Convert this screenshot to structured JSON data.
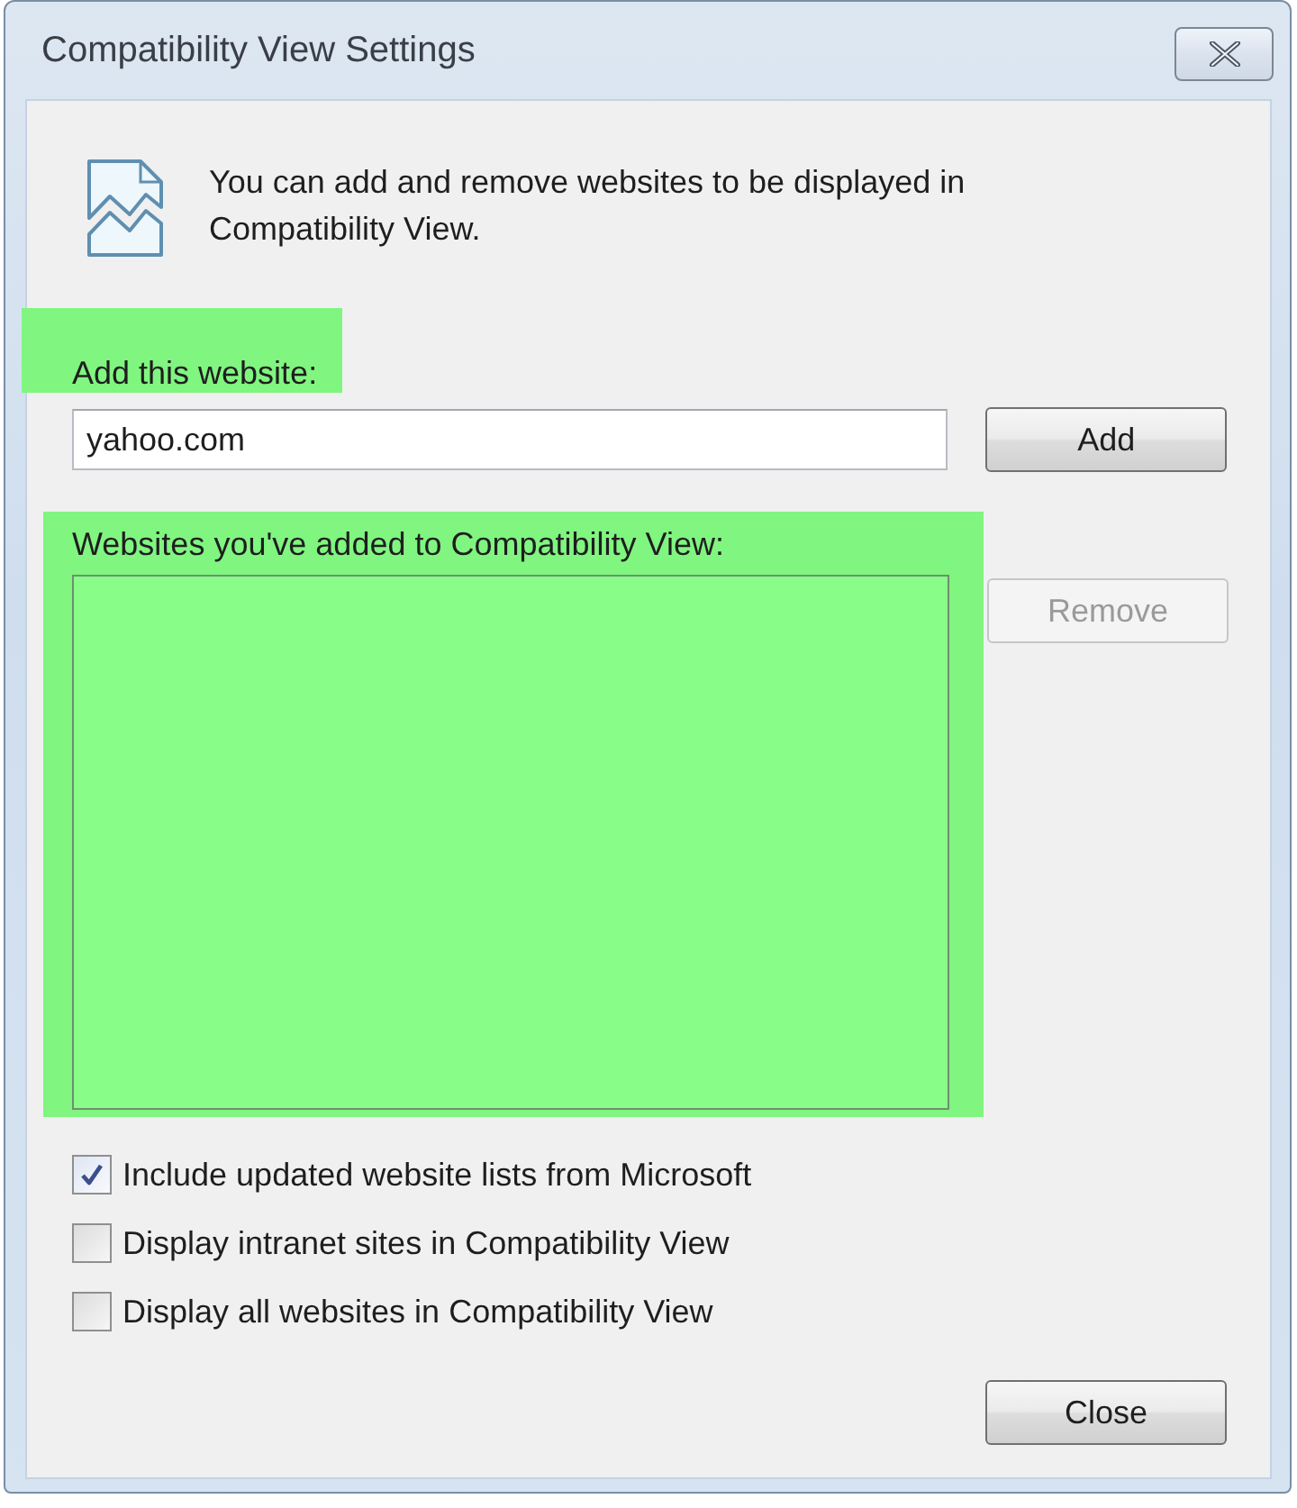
{
  "window": {
    "title": "Compatibility View Settings"
  },
  "intro": {
    "text": "You can add and remove websites to be displayed in Compatibility View."
  },
  "add_website": {
    "label": "Add this website:",
    "highlighted": true,
    "value": "yahoo.com",
    "button": {
      "label": "Add",
      "disabled": false
    }
  },
  "added_websites": {
    "label": "Websites you've added to Compatibility View:",
    "highlighted": true,
    "button": {
      "label": "Remove",
      "disabled": true
    }
  },
  "options": [
    {
      "label": "Include updated website lists from Microsoft",
      "checked": true
    },
    {
      "label": "Display intranet sites in Compatibility View",
      "checked": false
    },
    {
      "label": "Display all websites in Compatibility View",
      "checked": false
    }
  ],
  "buttons": [
    {
      "label": "Close",
      "disabled": false
    }
  ]
}
